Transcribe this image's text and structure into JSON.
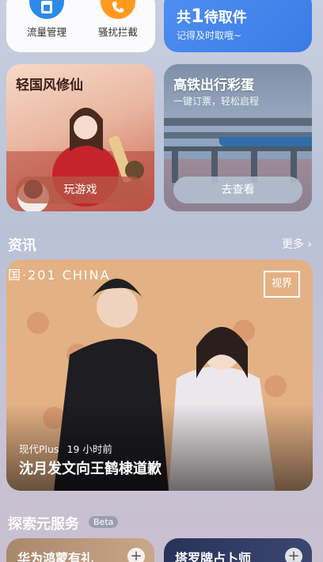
{
  "tools": [
    {
      "label": "流量管理",
      "icon": "sim-card-icon",
      "color": "#1e88e5"
    },
    {
      "label": "骚扰拦截",
      "icon": "phone-block-icon",
      "color": "#ff9800"
    }
  ],
  "pickup": {
    "prefix": "共",
    "count": "1",
    "suffix": "待取件",
    "sub": "记得及时取哦~"
  },
  "promos": [
    {
      "title": "轻国风修仙",
      "button": "玩游戏"
    },
    {
      "title": "高铁出行彩蛋",
      "subtitle": "一键订票，轻松启程",
      "button": "去查看"
    }
  ],
  "news_section": {
    "title": "资讯",
    "more": "更多"
  },
  "news": {
    "banner": "国·201 CHINA",
    "logo": "视界",
    "source": "现代Plus",
    "time": "19 小时前",
    "headline": "沈月发文向王鹤棣道歉"
  },
  "explore_section": {
    "title": "探索元服务",
    "badge": "Beta"
  },
  "services": [
    {
      "title": "华为鸿蒙有礼"
    },
    {
      "title": "塔罗牌占卜师"
    }
  ]
}
